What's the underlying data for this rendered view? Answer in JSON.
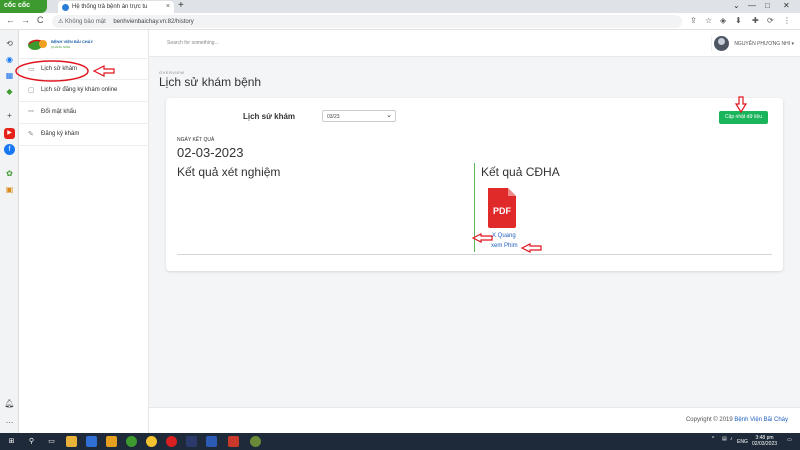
{
  "browser": {
    "brand": "cốc cốc",
    "tab_title": "Hệ thống trả bệnh án trực tu",
    "tab_close": "×",
    "new_tab": "+",
    "back": "←",
    "forward": "→",
    "reload": "C",
    "security_label": "Không bảo mật",
    "url": "benhvienbaichay.vn:82/history"
  },
  "sidebar": {
    "logo_text": "BỆNH VIỆN BÃI CHÁY",
    "logo_sub": "QUẢNG NINH",
    "items": [
      {
        "label": "Lịch sử khám"
      },
      {
        "label": "Lịch sử đăng ký khám online"
      },
      {
        "label": "Đổi mật khẩu"
      },
      {
        "label": "Đăng ký khám"
      }
    ]
  },
  "topbar": {
    "search_placeholder": "Search for something...",
    "user_name": "NGUYỄN PHƯƠNG NHI ▾"
  },
  "page": {
    "overview": "OVERVIEW",
    "title": "Lịch sử khám bệnh"
  },
  "card": {
    "heading": "Lịch sử khám",
    "select_value": "03/23",
    "update_button": "Cập nhật dữ liệu",
    "date_label": "NGÀY KẾT QUẢ",
    "date_value": "02-03-2023",
    "lab_results": "Kết quả xét nghiệm",
    "imaging_results": "Kết quả CĐHA",
    "pdf_label": "PDF",
    "link_xquang": "X Quang",
    "link_film": "xem Phim"
  },
  "footer": {
    "copyright": "Copyright © 2019 ",
    "brand": "Bệnh Viện Bãi Cháy"
  },
  "taskbar": {
    "lang": "ENG",
    "time": "3:48 pm",
    "date": "02/03/2023"
  },
  "colors": {
    "accent_green": "#1ab55a",
    "link_blue": "#1f5fbf",
    "annotation_red": "#e0141e"
  }
}
